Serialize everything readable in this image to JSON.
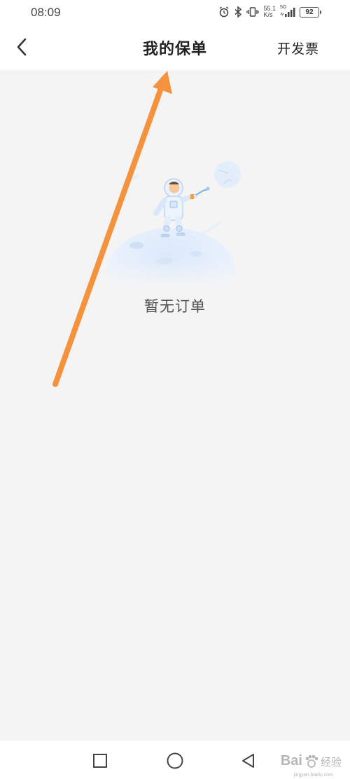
{
  "status_bar": {
    "time": "08:09",
    "net_speed_value": "55.1",
    "net_speed_unit": "K/s",
    "signal_label": "5G",
    "battery": "92",
    "icons": [
      "alarm-icon",
      "bluetooth-icon",
      "vibrate-icon",
      "signal-icon",
      "battery-icon"
    ]
  },
  "header": {
    "title": "我的保单",
    "action_label": "开发票",
    "back_icon": "chevron-left-icon"
  },
  "empty_state": {
    "message": "暂无订单",
    "illustration": "astronaut-on-moon"
  },
  "nav_bar": {
    "icons": [
      "recent-apps-icon",
      "home-icon",
      "back-icon"
    ]
  },
  "watermark": {
    "brand": "Bai",
    "brand_suffix": "经验",
    "url": "jingyan.baidu.com"
  },
  "colors": {
    "annotation_arrow": "#f5923e",
    "background": "#f4f4f4",
    "header_bg": "#ffffff"
  }
}
